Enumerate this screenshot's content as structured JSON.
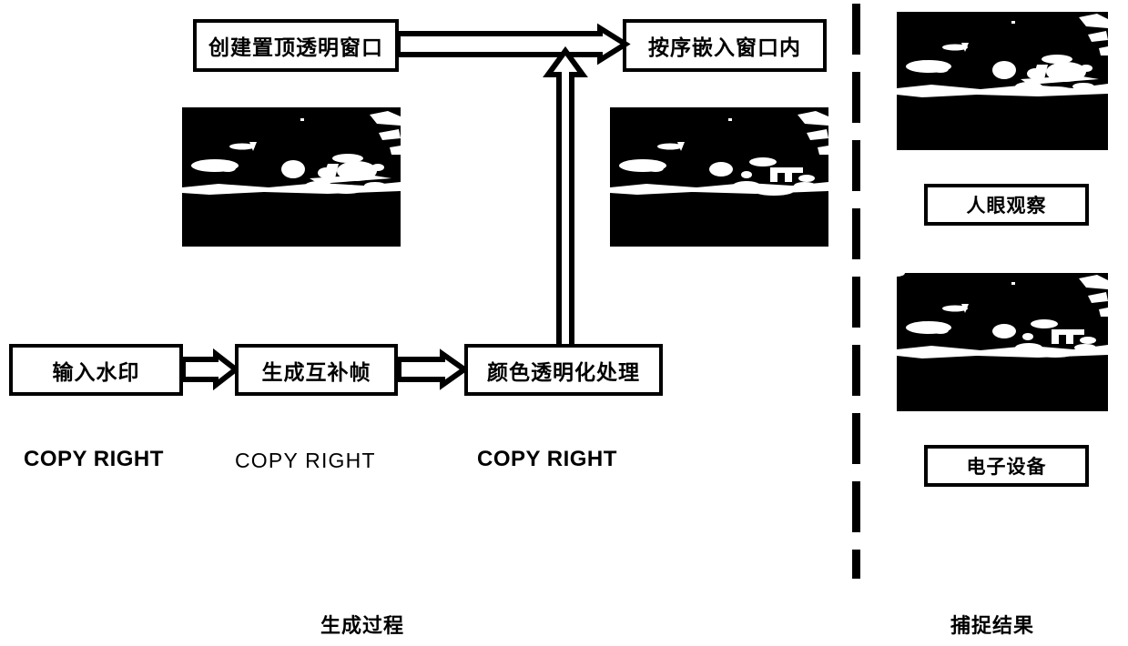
{
  "diagram": {
    "title_left": "生成过程",
    "title_right": "捕捉结果",
    "left_panel": {
      "boxes": [
        {
          "id": "create-top-transparent-window",
          "label": "创建置顶透明窗口"
        },
        {
          "id": "embed-into-window-in-order",
          "label": "按序嵌入窗口内"
        },
        {
          "id": "input-watermark",
          "label": "输入水印"
        },
        {
          "id": "generate-complementary-frame",
          "label": "生成互补帧"
        },
        {
          "id": "color-transparency-process",
          "label": "颜色透明化处理"
        }
      ],
      "watermark_labels": [
        {
          "id": "copy-right-bold-1",
          "text": "COPY RIGHT"
        },
        {
          "id": "copy-right-light-2",
          "text": "COPY RIGHT"
        },
        {
          "id": "copy-right-bold-3",
          "text": "COPY RIGHT"
        }
      ],
      "thumbnails": [
        {
          "id": "complementary-frame-preview-a",
          "alt": "high contrast black and white still frame"
        },
        {
          "id": "complementary-frame-preview-b",
          "alt": "high contrast black and white still frame with watermark"
        }
      ]
    },
    "right_panel": {
      "boxes": [
        {
          "id": "human-eye-observation",
          "label": "人眼观察"
        },
        {
          "id": "electronic-device",
          "label": "电子设备"
        }
      ],
      "thumbnails": [
        {
          "id": "capture-result-human-eye",
          "alt": "captured frame as seen by human eye"
        },
        {
          "id": "capture-result-device",
          "alt": "captured frame as recorded by device showing watermark"
        }
      ]
    },
    "colors": {
      "stroke": "#000000",
      "background": "#ffffff",
      "photo_fill": "#000000",
      "photo_highlight": "#ffffff"
    },
    "icons": {
      "arrow_right": "block-arrow-right-icon",
      "arrow_up": "block-arrow-up-icon",
      "divider": "dashed-vertical-divider-icon"
    }
  }
}
